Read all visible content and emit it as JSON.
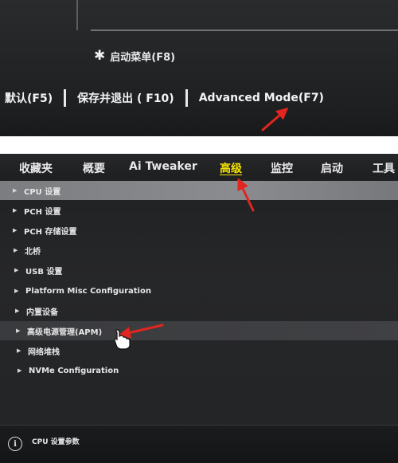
{
  "top_screen": {
    "boot_menu": {
      "icon": "gear-icon",
      "label": "启动菜单(F8)"
    },
    "footer_keys": [
      {
        "label": "默认(F5)"
      },
      {
        "label": "保存并退出 ( F10)"
      },
      {
        "label": "Advanced Mode(F7)"
      }
    ]
  },
  "bottom_screen": {
    "tabs": [
      {
        "label": "收藏夹"
      },
      {
        "label": "概要"
      },
      {
        "label": "Ai Tweaker"
      },
      {
        "label": "高级",
        "active": true
      },
      {
        "label": "监控"
      },
      {
        "label": "启动"
      },
      {
        "label": "工具"
      }
    ],
    "menu_items": [
      {
        "label": "CPU 设置",
        "highlighted": true
      },
      {
        "label": "PCH 设置"
      },
      {
        "label": "PCH 存储设置"
      },
      {
        "label": "北桥"
      },
      {
        "label": "USB 设置"
      },
      {
        "label": "Platform Misc Configuration"
      },
      {
        "label": "内置设备"
      },
      {
        "label": "高级电源管理(APM)",
        "hovered": true
      },
      {
        "label": "网络堆栈"
      },
      {
        "label": "NVMe Configuration"
      }
    ],
    "info": {
      "icon": "info-icon",
      "text": "CPU 设置参数"
    }
  },
  "colors": {
    "active_tab": "#f6e200",
    "annotation_arrow": "#e0261f",
    "highlight_row": "#868789"
  }
}
